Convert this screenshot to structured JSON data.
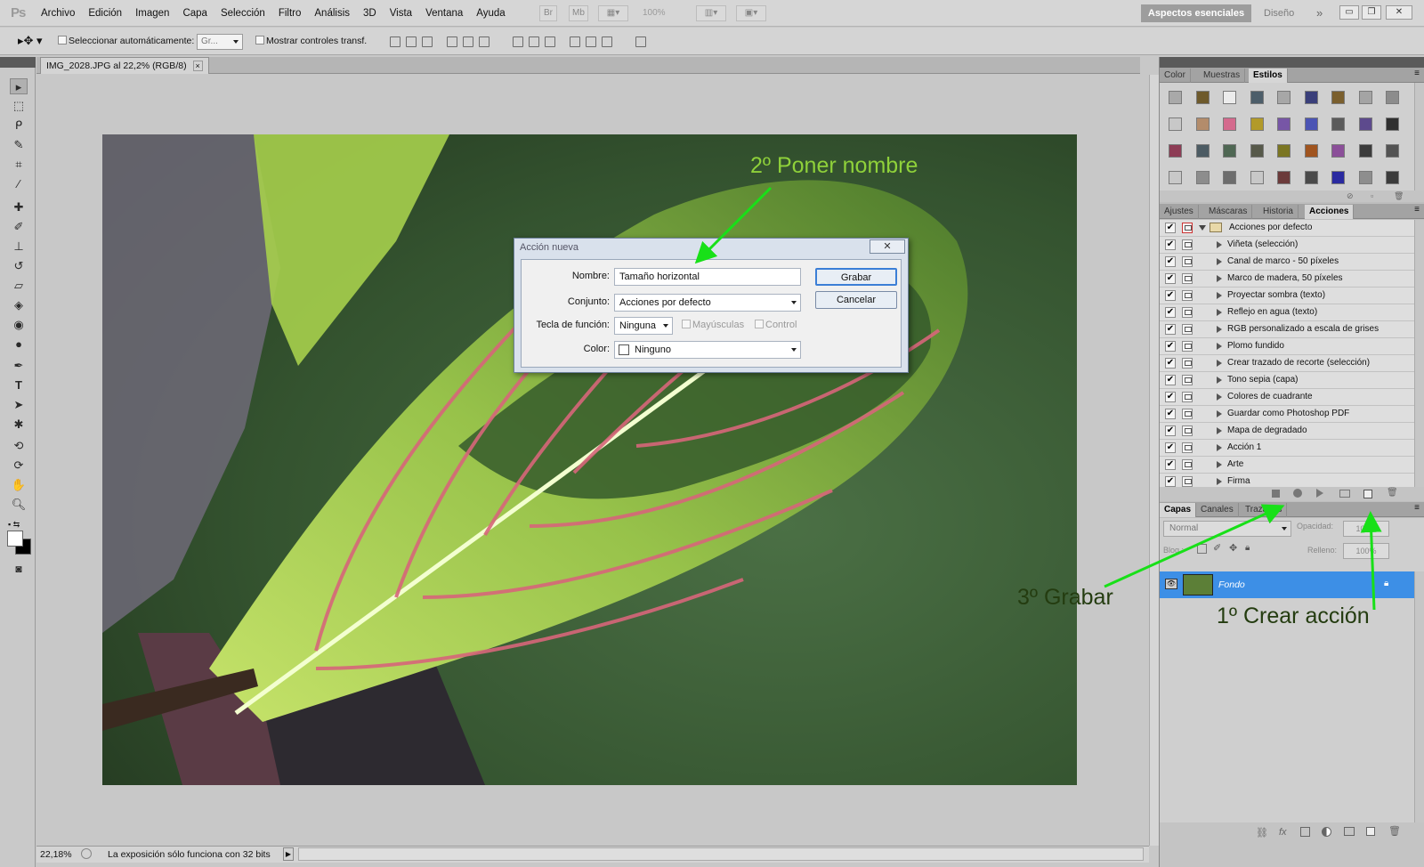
{
  "app": {
    "logo": "Ps"
  },
  "menubar": {
    "items": [
      "Archivo",
      "Edición",
      "Imagen",
      "Capa",
      "Selección",
      "Filtro",
      "Análisis",
      "3D",
      "Vista",
      "Ventana",
      "Ayuda"
    ],
    "zoom": "100%",
    "workspace_active": "Aspectos esenciales",
    "workspace_other": "Diseño",
    "more": "»"
  },
  "options": {
    "auto_select_label": "Seleccionar automáticamente:",
    "auto_select_value": "Gr...",
    "show_transform_label": "Mostrar controles transf."
  },
  "document": {
    "tab_title": "IMG_2028.JPG al 22,2% (RGB/8)",
    "tab_close": "×"
  },
  "status": {
    "zoom": "22,18%",
    "message": "La exposición sólo funciona con 32 bits"
  },
  "swatch_panel": {
    "tabs": [
      "Color",
      "Muestras",
      "Estilos"
    ],
    "active_tab": "Estilos",
    "styles": [
      "#a9a9a9",
      "#6e5a2c",
      "#ececec",
      "#4d5e6a",
      "#a7a7a7",
      "#3a3f7a",
      "#7a5f2e",
      "#a4a4a4",
      "#8c8c8c",
      "#c8c8c8",
      "#b38c6b",
      "#d46a8d",
      "#b29a2a",
      "#7756a6",
      "#4b54b4",
      "#5b5b5b",
      "#5d4a8d",
      "#2f2f2f",
      "#8d3c55",
      "#4c5b63",
      "#4f6753",
      "#57594a",
      "#7b7623",
      "#a0541f",
      "#8b4f99",
      "#3c3c3c",
      "#535353",
      "#c8c8c8",
      "#8d8d8d",
      "#6d6d6d",
      "#c8c8c8",
      "#6b3a3a",
      "#4a4a4a",
      "#2a2aa0",
      "#8e8e8e",
      "#3b3b3b"
    ]
  },
  "actions_panel": {
    "tabs": [
      "Ajustes",
      "Máscaras",
      "Historia",
      "Acciones"
    ],
    "active_tab": "Acciones",
    "set_name": "Acciones por defecto",
    "items": [
      "Viñeta (selección)",
      "Canal de marco - 50 píxeles",
      "Marco de madera, 50 píxeles",
      "Proyectar sombra (texto)",
      "Reflejo en agua (texto)",
      "RGB personalizado a escala de grises",
      "Plomo fundido",
      "Crear trazado de recorte (selección)",
      "Tono sepia (capa)",
      "Colores de cuadrante",
      "Guardar como Photoshop PDF",
      "Mapa de degradado",
      "Acción 1",
      "Arte",
      "Firma"
    ]
  },
  "layers_panel": {
    "tabs": [
      "Capas",
      "Canales",
      "Trazados"
    ],
    "active_tab": "Capas",
    "blend_mode": "Normal",
    "opacity_label": "Opacidad:",
    "opacity_value": "100%",
    "lock_label": "Bloq.:",
    "fill_label": "Relleno:",
    "fill_value": "100%",
    "layer_name": "Fondo"
  },
  "dialog": {
    "title": "Acción nueva",
    "close": "✕",
    "name_label": "Nombre:",
    "name_value": "Tamaño horizontal",
    "set_label": "Conjunto:",
    "set_value": "Acciones por defecto",
    "fkey_label": "Tecla de función:",
    "fkey_value": "Ninguna",
    "shift_label": "Mayúsculas",
    "control_label": "Control",
    "color_label": "Color:",
    "color_value": "Ninguno",
    "ok": "Grabar",
    "cancel": "Cancelar"
  },
  "annotations": {
    "step2": "2º  Poner nombre",
    "step3": "3º  Grabar",
    "step1": "1º  Crear acción"
  },
  "colors": {
    "annotation_light": "#8fd13a",
    "annotation_dark": "#243c10",
    "arrow": "#18e018",
    "selected_layer": "#3d8fe6"
  }
}
